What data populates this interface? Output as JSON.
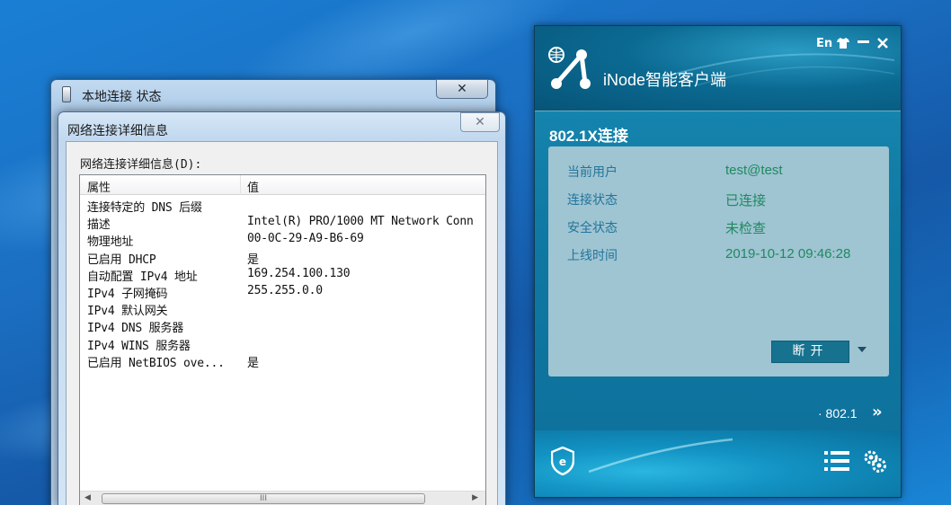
{
  "status_window": {
    "title": "本地连接 状态",
    "close_glyph": "✕"
  },
  "detail_window": {
    "title": "网络连接详细信息",
    "close_glyph": "✕",
    "group_label": "网络连接详细信息(D):",
    "columns": [
      "属性",
      "值"
    ],
    "rows": [
      {
        "property": "连接特定的 DNS 后缀",
        "value": ""
      },
      {
        "property": "描述",
        "value": "Intel(R) PRO/1000 MT Network Conn"
      },
      {
        "property": "物理地址",
        "value": "00-0C-29-A9-B6-69"
      },
      {
        "property": "已启用 DHCP",
        "value": "是"
      },
      {
        "property": "自动配置 IPv4 地址",
        "value": "169.254.100.130"
      },
      {
        "property": "IPv4 子网掩码",
        "value": "255.255.0.0"
      },
      {
        "property": "IPv4 默认网关",
        "value": ""
      },
      {
        "property": "IPv4 DNS 服务器",
        "value": ""
      },
      {
        "property": "IPv4 WINS 服务器",
        "value": ""
      },
      {
        "property": "已启用 NetBIOS ove...",
        "value": "是"
      }
    ],
    "scroll_left": "◀",
    "scroll_right": "▶",
    "scroll_grip": "III"
  },
  "inode": {
    "brand": "iNode智能客户端",
    "top_controls": {
      "lang": "En"
    },
    "connection_title": "802.1X连接",
    "info": [
      {
        "label": "当前用户",
        "value": "test@test"
      },
      {
        "label": "连接状态",
        "value": "已连接"
      },
      {
        "label": "安全状态",
        "value": "未检查"
      },
      {
        "label": "上线时间",
        "value": "2019-10-12 09:46:28"
      }
    ],
    "disconnect_label": "断开",
    "mode_label": "· 802.1",
    "mode_arrow": "»",
    "colors": {
      "panel": "#9fc4d2",
      "label": "#23759a",
      "value": "#1e8a5f",
      "button": "#16728f"
    }
  }
}
